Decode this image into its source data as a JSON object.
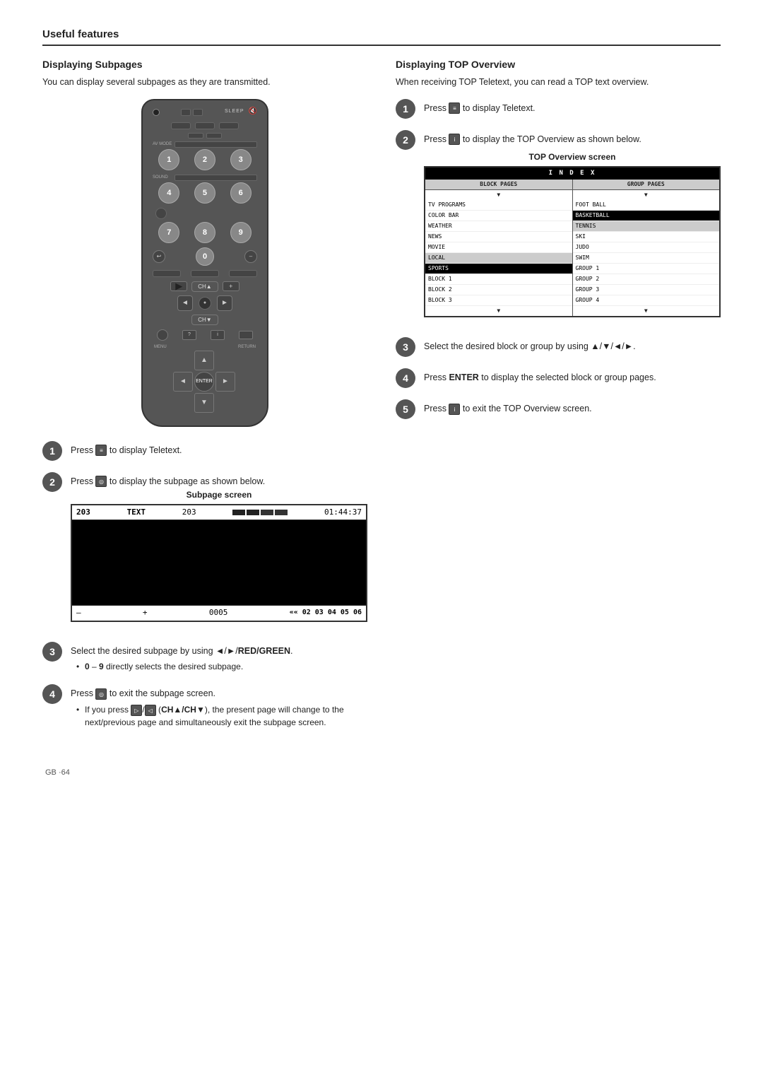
{
  "header": {
    "title": "Useful features"
  },
  "left_section": {
    "title": "Displaying Subpages",
    "intro": "You can display several subpages as they are transmitted.",
    "steps": [
      {
        "num": "1",
        "text": "Press",
        "icon": "teletext-icon",
        "text_after": " to display Teletext."
      },
      {
        "num": "2",
        "text": "Press",
        "icon": "circle-icon",
        "text_after": " to display the subpage as shown below."
      },
      {
        "num": "3",
        "text": "Select the desired subpage by using ◄/►/",
        "bold": "RED/GREEN",
        "text_after": ".",
        "bullet1": "0 – 9 directly selects the desired subpage."
      },
      {
        "num": "4",
        "text": "Press",
        "icon": "circle-icon",
        "text_after": " to exit the subpage screen.",
        "bullet1": "If you press",
        "bullet1_icons": "prev/next icons",
        "bullet1_bold": "(CH▲/CH▼)",
        "bullet1_after": ", the present page will change to the next/previous page and simultaneously exit the subpage screen."
      }
    ],
    "subpage_screen": {
      "label": "Subpage screen",
      "header_left": "203",
      "header_mid": "TEXT",
      "header_mid2": "203",
      "header_right": "01:44:37",
      "footer_minus": "–",
      "footer_plus": "+",
      "footer_page": "0005",
      "footer_nums": "«« 02  03  04  05  06"
    }
  },
  "right_section": {
    "title": "Displaying TOP Overview",
    "intro": "When receiving TOP Teletext, you can read a TOP text overview.",
    "steps": [
      {
        "num": "1",
        "text": "Press",
        "icon": "teletext-icon",
        "text_after": " to display Teletext."
      },
      {
        "num": "2",
        "text": "Press",
        "icon": "info-icon",
        "text_after": " to display the TOP Overview as shown below."
      },
      {
        "num": "3",
        "text": "Select the desired block or group by using ▲/▼/◄/►."
      },
      {
        "num": "4",
        "text": "Press",
        "bold": "ENTER",
        "text_after": " to display the selected block or group pages."
      },
      {
        "num": "5",
        "text": "Press",
        "icon": "info-icon",
        "text_after": " to exit the TOP Overview screen."
      }
    ],
    "top_overview": {
      "label": "TOP Overview screen",
      "header": "I N D E X",
      "left_col_header": "BLOCK PAGES",
      "right_col_header": "GROUP PAGES",
      "left_items": [
        {
          "text": "▼",
          "type": "arrow"
        },
        {
          "text": "TV PROGRAMS",
          "type": "normal"
        },
        {
          "text": "COLOR BAR",
          "type": "normal"
        },
        {
          "text": "WEATHER",
          "type": "normal"
        },
        {
          "text": "NEWS",
          "type": "normal"
        },
        {
          "text": "MOVIE",
          "type": "normal"
        },
        {
          "text": "LOCAL",
          "type": "highlighted"
        },
        {
          "text": "SPORTS",
          "type": "highlighted"
        },
        {
          "text": "BLOCK 1",
          "type": "normal"
        },
        {
          "text": "BLOCK 2",
          "type": "normal"
        },
        {
          "text": "BLOCK 3",
          "type": "normal"
        },
        {
          "text": "▼",
          "type": "arrow"
        }
      ],
      "right_items": [
        {
          "text": "▼",
          "type": "arrow"
        },
        {
          "text": "FOOT BALL",
          "type": "normal"
        },
        {
          "text": "BASKETBALL",
          "type": "normal"
        },
        {
          "text": "TENNIS",
          "type": "highlighted"
        },
        {
          "text": "SKI",
          "type": "normal"
        },
        {
          "text": "JUDO",
          "type": "normal"
        },
        {
          "text": "SWIM",
          "type": "normal"
        },
        {
          "text": "GROUP 1",
          "type": "normal"
        },
        {
          "text": "GROUP 2",
          "type": "normal"
        },
        {
          "text": "GROUP 3",
          "type": "normal"
        },
        {
          "text": "GROUP 4",
          "type": "normal"
        },
        {
          "text": "▼",
          "type": "arrow"
        }
      ]
    }
  },
  "remote": {
    "numbers": [
      "1",
      "2",
      "3",
      "4",
      "5",
      "6",
      "7",
      "8",
      "9",
      "0"
    ],
    "av_mode_label": "AV MODE",
    "sound_label": "SOUND",
    "menu_label": "MENU",
    "return_label": "RETURN",
    "enter_label": "ENTER",
    "ch_up": "CH▲",
    "ch_down": "CH▼"
  },
  "footer": {
    "page": "GB ·64"
  }
}
